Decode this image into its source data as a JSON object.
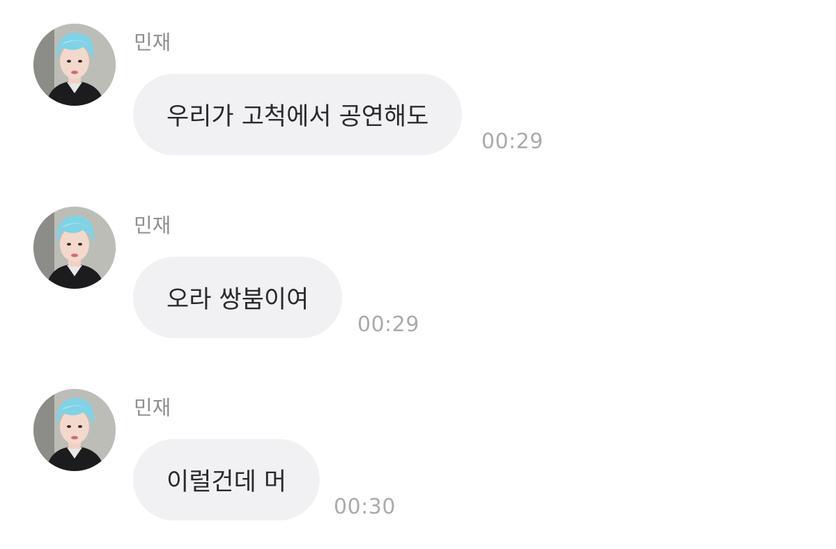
{
  "messages": [
    {
      "sender": "민재",
      "text": "우리가 고척에서 공연해도",
      "time": "00:29"
    },
    {
      "sender": "민재",
      "text": "오라 쌍붐이여",
      "time": "00:29"
    },
    {
      "sender": "민재",
      "text": "이럴건데 머",
      "time": "00:30"
    }
  ],
  "colors": {
    "bubble": "#f1f1f3",
    "text": "#2a2a2c",
    "sender": "#8f8f93",
    "time": "#aaaaae",
    "avatar_hair": "#7fd3e6"
  },
  "icons": {
    "avatar": "profile-photo-avatar"
  }
}
